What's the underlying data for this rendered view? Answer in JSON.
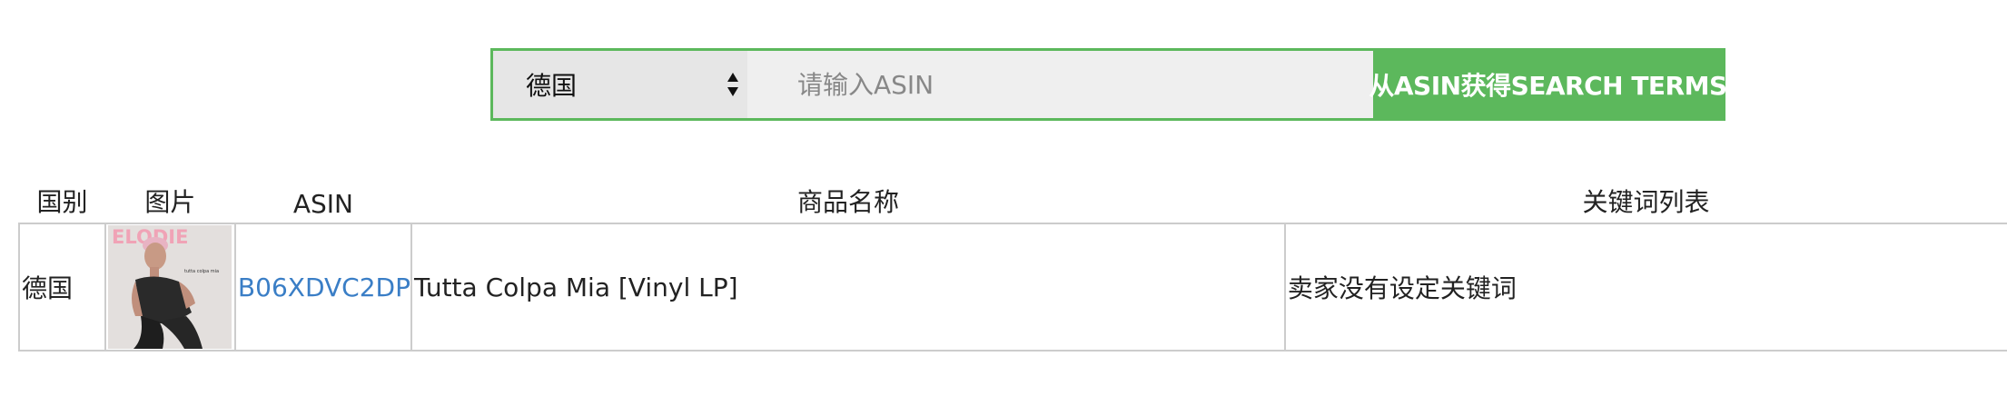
{
  "search": {
    "country_selected": "德国",
    "asin_placeholder": "请输入ASIN",
    "asin_value": "",
    "submit_label": "从ASIN获得SEARCH TERMS"
  },
  "table": {
    "headers": {
      "country": "国别",
      "image": "图片",
      "asin": "ASIN",
      "name": "商品名称",
      "keywords": "关键词列表"
    },
    "rows": [
      {
        "country": "德国",
        "image_alt": "album cover",
        "cover_text": "ELODIE",
        "cover_subtext": "tutta colpa mia",
        "asin": "B06XDVC2DP",
        "name": "Tutta Colpa Mia [Vinyl LP]",
        "keywords": "卖家没有设定关键词"
      }
    ]
  },
  "colors": {
    "accent_green": "#5cb85c",
    "link_blue": "#3a7ec6",
    "border_gray": "#cccccc"
  },
  "icons": {
    "select_arrows": "up-down-arrows-icon"
  }
}
